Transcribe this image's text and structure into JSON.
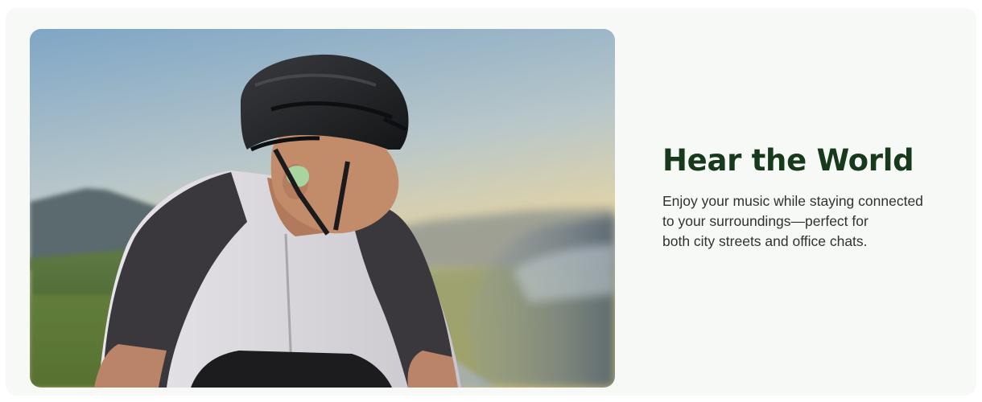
{
  "hero": {
    "image": {
      "description_icon": "cyclist-with-open-ear-earbuds-photo"
    },
    "headline": "Hear the World",
    "body_lines": [
      "Enjoy your music while staying connected",
      "to your surroundings—perfect for",
      "both city streets and office chats."
    ]
  },
  "colors": {
    "background": "#ffffff",
    "card": "#f7f9f6",
    "headline": "#17391c",
    "body_text": "#2f332f",
    "earbud_accent": "#a8d4a0"
  }
}
